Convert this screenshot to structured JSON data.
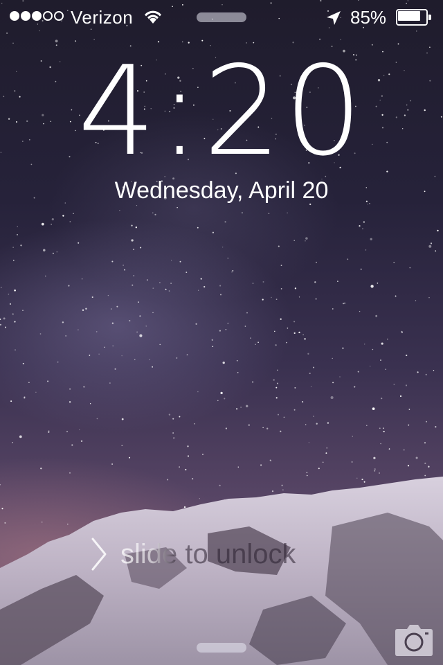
{
  "status_bar": {
    "signal_strength": {
      "filled": 3,
      "total": 5
    },
    "carrier": "Verizon",
    "wifi_icon": "wifi-icon",
    "location_icon": "location-arrow-icon",
    "battery_percent_label": "85%",
    "battery_level": 0.85
  },
  "lock_screen": {
    "time": "4:20",
    "date": "Wednesday, April 20",
    "slide_label": "slide to unlock",
    "chevron_icon": "chevron-right-icon",
    "camera_icon": "camera-icon"
  },
  "colors": {
    "text": "#ffffff",
    "sky_top": "#1f1c2c",
    "sky_bottom": "#6e5670",
    "snow": "#c9c1d0"
  }
}
